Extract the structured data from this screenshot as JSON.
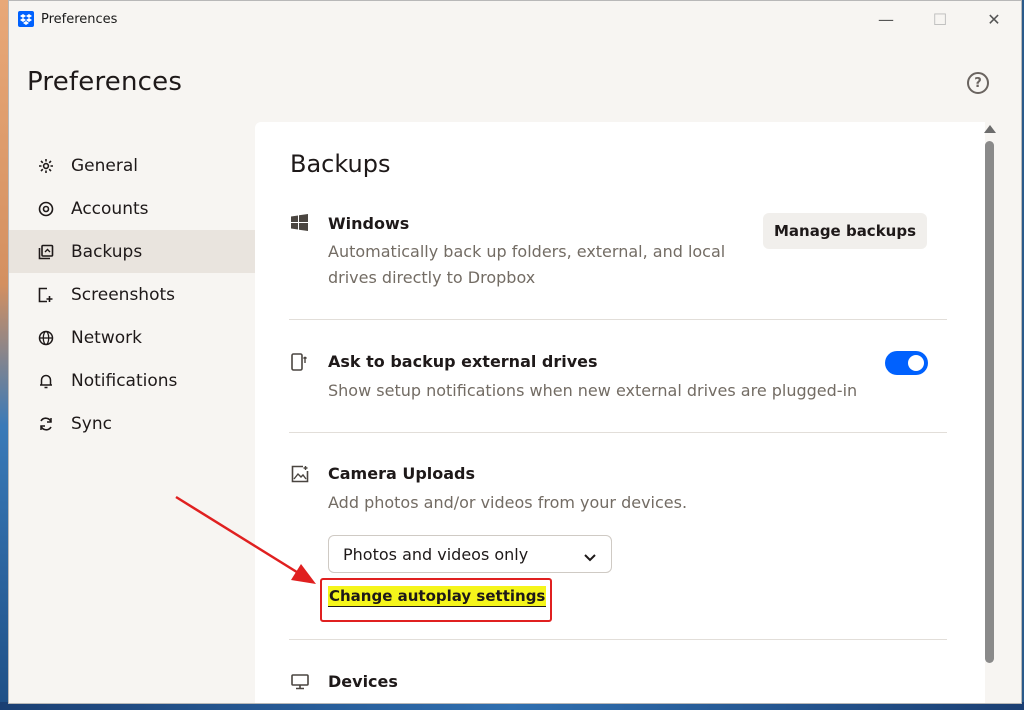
{
  "window": {
    "title": "Preferences",
    "controls": {
      "minimize": "—",
      "maximize": "☐",
      "close": "✕"
    }
  },
  "page": {
    "heading": "Preferences",
    "help_icon": "?"
  },
  "sidebar": {
    "items": [
      {
        "label": "General",
        "icon": "gear-icon",
        "active": false
      },
      {
        "label": "Accounts",
        "icon": "at-icon",
        "active": false
      },
      {
        "label": "Backups",
        "icon": "backup-icon",
        "active": true
      },
      {
        "label": "Screenshots",
        "icon": "screenshot-icon",
        "active": false
      },
      {
        "label": "Network",
        "icon": "globe-icon",
        "active": false
      },
      {
        "label": "Notifications",
        "icon": "bell-icon",
        "active": false
      },
      {
        "label": "Sync",
        "icon": "sync-icon",
        "active": false
      }
    ]
  },
  "main": {
    "section_title": "Backups",
    "windows": {
      "title": "Windows",
      "description_line1": "Automatically back up folders, external, and local",
      "description_line2": "drives directly to Dropbox",
      "button": "Manage backups"
    },
    "external_drives": {
      "title": "Ask to backup external drives",
      "description": "Show setup notifications when new external drives are plugged-in",
      "toggle_on": true
    },
    "camera_uploads": {
      "title": "Camera Uploads",
      "description": "Add photos and/or videos from your devices.",
      "dropdown_value": "Photos and videos only",
      "link": "Change autoplay settings"
    },
    "devices": {
      "title": "Devices"
    }
  },
  "colors": {
    "accent": "#0061fe",
    "annotation": "#e02020",
    "highlight": "#f5f51a"
  }
}
